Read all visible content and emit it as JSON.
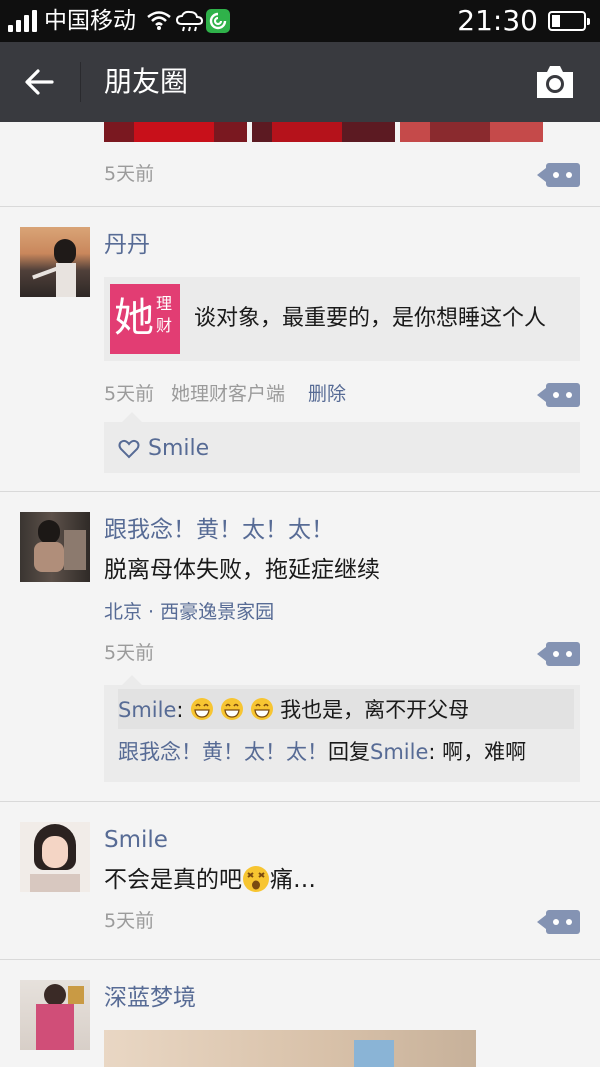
{
  "status_bar": {
    "carrier": "中国移动",
    "time": "21:30"
  },
  "header": {
    "title": "朋友圈"
  },
  "icons": [
    "signal-icon",
    "wifi-icon",
    "weather-icon",
    "360-app-icon",
    "battery-icon",
    "back-arrow-icon",
    "camera-icon",
    "comment-icon",
    "heart-icon",
    "grin-emoji",
    "shock-emoji"
  ],
  "colors": {
    "name_link": "#576b95",
    "header_bg": "#393a3f",
    "status_bg": "#0f0f0f",
    "comment_btn": "#8493b3",
    "card_bg": "#ebebeb"
  },
  "posts": [
    {
      "time": "5天前"
    },
    {
      "name": "丹丹",
      "link_title": "谈对象，最重要的，是你想睡这个人",
      "link_logo_main": "她",
      "link_logo_sub1": "理",
      "link_logo_sub2": "财",
      "time": "5天前",
      "source": "她理财客户端",
      "delete_label": "删除",
      "likes": "Smile"
    },
    {
      "name": "跟我念！黄！太！太！",
      "text": "脱离母体失败，拖延症继续",
      "location": "北京 · 西豪逸景家园",
      "time": "5天前",
      "comments": [
        {
          "author": "Smile",
          "sep": ": ",
          "body": "我也是，离不开父母"
        },
        {
          "author": "跟我念！黄！太！太！",
          "reply_word": "回复",
          "target": "Smile",
          "sep": ": ",
          "body": "啊，难啊"
        }
      ]
    },
    {
      "name": "Smile",
      "text_before": "不会是真的吧",
      "text_after": "痛…",
      "time": "5天前"
    },
    {
      "name": "深蓝梦境"
    }
  ]
}
